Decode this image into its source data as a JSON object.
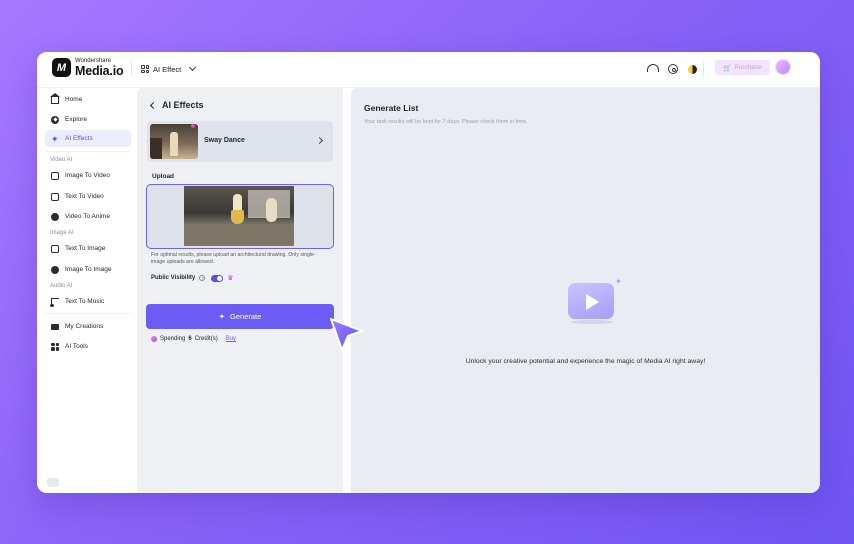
{
  "brand": {
    "top": "Wondershare",
    "main": "Media.io",
    "mark": "M"
  },
  "header": {
    "menu_label": "AI Effect",
    "purchase_label": "Purchase",
    "icons": [
      "grid-icon",
      "chevron-down-icon",
      "headset-icon",
      "settings-icon",
      "theme-icon",
      "cart-icon",
      "avatar"
    ]
  },
  "sidebar": {
    "items": [
      {
        "label": "Home",
        "icon": "home-icon"
      },
      {
        "label": "Explore",
        "icon": "compass-icon"
      },
      {
        "label": "AI Effects",
        "icon": "sparkle-icon",
        "active": true
      },
      {
        "label": "Image To Video",
        "icon": "video-icon"
      },
      {
        "label": "Text To Video",
        "icon": "text-video-icon"
      },
      {
        "label": "Video To Anime",
        "icon": "anime-icon"
      },
      {
        "label": "Text To Image",
        "icon": "image-icon"
      },
      {
        "label": "Image To Image",
        "icon": "image-swap-icon"
      },
      {
        "label": "Text To Music",
        "icon": "music-icon"
      },
      {
        "label": "My Creations",
        "icon": "folder-icon"
      },
      {
        "label": "AI Tools",
        "icon": "tools-icon"
      }
    ],
    "sections": {
      "video": "Video AI",
      "image": "Image AI",
      "audio": "Audio AI"
    }
  },
  "panel": {
    "title": "AI Effects",
    "effect_name": "Sway Dance",
    "upload_label": "Upload",
    "hint": "For optimal results, please upload an architectural drawing. Only single-image uploads are allowed.",
    "visibility_label": "Public Visibility",
    "visibility_on": true,
    "generate_label": "Generate",
    "spending_prefix": "Spending",
    "spending_value": "6",
    "spending_suffix": "Credit(s)",
    "buy_label": "Buy"
  },
  "main": {
    "title": "Generate List",
    "subtitle": "Your task results will be kept for 7 days. Please check them in time.",
    "empty_message": "Unlock your creative potential and experience the magic of Media AI right away!"
  },
  "colors": {
    "accent": "#6b5cf6",
    "background_gradient_start": "#a578ff",
    "background_gradient_end": "#6f55f2"
  }
}
